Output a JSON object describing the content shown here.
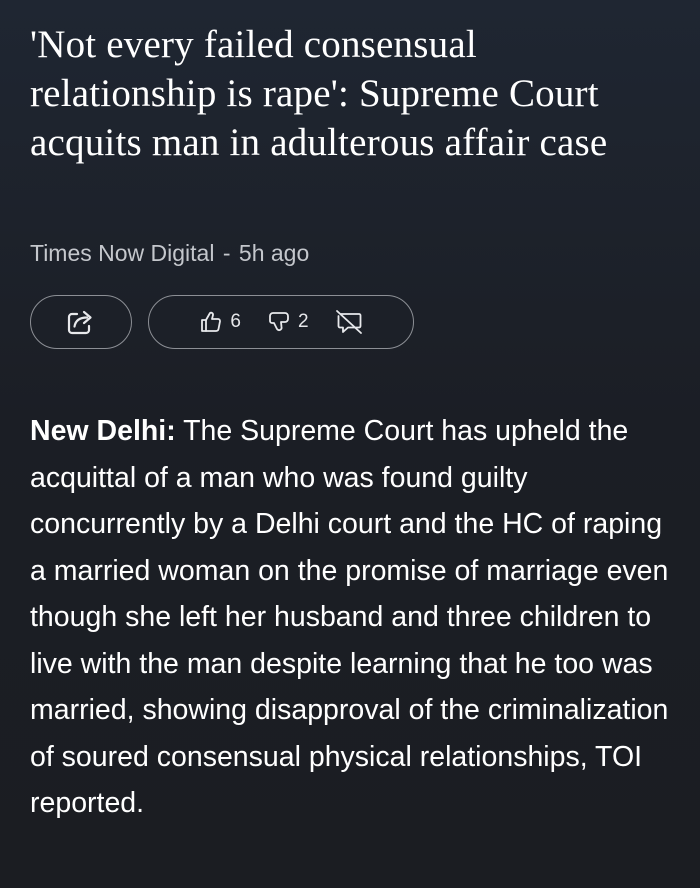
{
  "article": {
    "headline": "'Not every failed consensual relationship is rape': Supreme Court acquits man in adulterous affair case",
    "source": "Times Now Digital",
    "separator": "-",
    "time_ago": "5h ago",
    "body_lead": "New Delhi:",
    "body_text": "The Supreme Court has upheld the acquittal of a man who was found guilty concurrently by a Delhi court and the HC of raping a married woman on the promise of marriage even though she left her husband and three children to live with the man despite learning that he too was married, showing disapproval of the criminalization of soured consensual physical relationships, TOI reported."
  },
  "actions": {
    "share_icon": "share-icon",
    "like_icon": "thumbs-up-icon",
    "like_count": "6",
    "dislike_icon": "thumbs-down-icon",
    "dislike_count": "2",
    "hide_icon": "hide-comment-icon"
  },
  "colors": {
    "background_top": "#1f2632",
    "background_bottom": "#1b1d22",
    "text_primary": "#ffffff",
    "text_secondary": "#c4c7cc",
    "pill_border": "#8c8f95"
  }
}
